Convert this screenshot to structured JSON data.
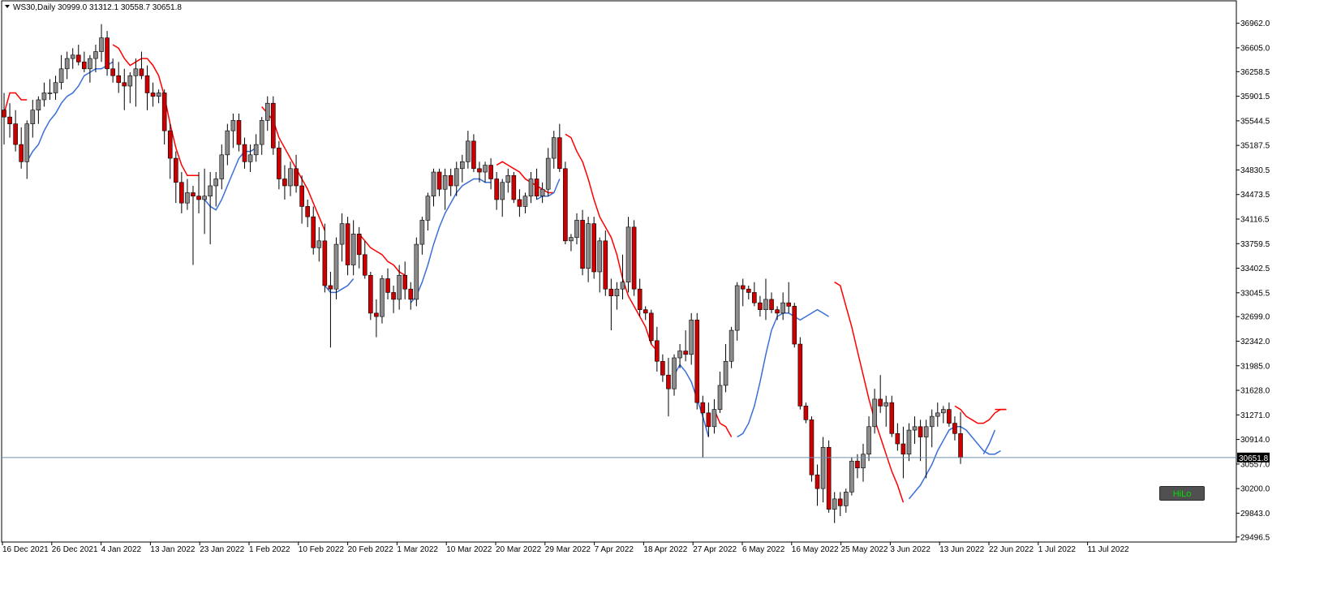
{
  "chart_header": {
    "symbol_info": "WS30,Daily  30999.0 31312.1 30558.7 30651.8"
  },
  "indicator_button": {
    "label": "HiLo"
  },
  "colors": {
    "up_candle": "#8c8c8c",
    "down_candle": "#cc0000",
    "hilo_upper": "#ff0000",
    "hilo_lower": "#3a6fd8",
    "price_line": "#6f8faf",
    "current_price_bg": "#000000",
    "current_price_text": "#ffffff"
  },
  "chart_data": {
    "type": "candlestick",
    "symbol": "WS30",
    "timeframe": "Daily",
    "ohlc_last": {
      "open": 30999.0,
      "high": 31312.1,
      "low": 30558.7,
      "close": 30651.8
    },
    "current_price": "30651.8",
    "y_ticks": [
      "36962.0",
      "36605.0",
      "36258.5",
      "35901.5",
      "35544.5",
      "35187.5",
      "34830.5",
      "34473.5",
      "34116.5",
      "33759.5",
      "33402.5",
      "33045.5",
      "32699.0",
      "32342.0",
      "31985.0",
      "31628.0",
      "31271.0",
      "30914.0",
      "30557.0",
      "30200.0",
      "29843.0",
      "29496.5"
    ],
    "ylim": [
      29400,
      37300
    ],
    "x_tick_labels": [
      "16 Dec 2021",
      "26 Dec 2021",
      "4 Jan 2022",
      "13 Jan 2022",
      "23 Jan 2022",
      "1 Feb 2022",
      "10 Feb 2022",
      "20 Feb 2022",
      "1 Mar 2022",
      "10 Mar 2022",
      "20 Mar 2022",
      "29 Mar 2022",
      "7 Apr 2022",
      "18 Apr 2022",
      "27 Apr 2022",
      "6 May 2022",
      "16 May 2022",
      "25 May 2022",
      "3 Jun 2022",
      "13 Jun 2022",
      "22 Jun 2022",
      "1 Jul 2022",
      "11 Jul 2022"
    ],
    "candles": [
      [
        35700,
        35950,
        35200,
        35600
      ],
      [
        35600,
        35800,
        35300,
        35500
      ],
      [
        35500,
        35700,
        35100,
        35200
      ],
      [
        35200,
        35450,
        34850,
        34950
      ],
      [
        34950,
        35550,
        34700,
        35500
      ],
      [
        35500,
        35850,
        35300,
        35700
      ],
      [
        35700,
        35900,
        35500,
        35850
      ],
      [
        35850,
        36100,
        35750,
        35950
      ],
      [
        35950,
        36150,
        35850,
        35950
      ],
      [
        35950,
        36200,
        35850,
        36100
      ],
      [
        36100,
        36500,
        36000,
        36300
      ],
      [
        36300,
        36550,
        36150,
        36450
      ],
      [
        36450,
        36600,
        36300,
        36500
      ],
      [
        36500,
        36650,
        36350,
        36400
      ],
      [
        36400,
        36550,
        36250,
        36300
      ],
      [
        36300,
        36500,
        36100,
        36450
      ],
      [
        36450,
        36650,
        36250,
        36550
      ],
      [
        36550,
        36950,
        36400,
        36750
      ],
      [
        36750,
        36850,
        36200,
        36300
      ],
      [
        36300,
        36450,
        36100,
        36200
      ],
      [
        36200,
        36400,
        35950,
        36100
      ],
      [
        36100,
        36300,
        35700,
        36050
      ],
      [
        36050,
        36250,
        35800,
        36200
      ],
      [
        36200,
        36450,
        35750,
        36300
      ],
      [
        36300,
        36550,
        36150,
        36200
      ],
      [
        36200,
        36350,
        35700,
        35950
      ],
      [
        35950,
        36100,
        35750,
        35900
      ],
      [
        35900,
        36000,
        35800,
        35950
      ],
      [
        35950,
        36000,
        35200,
        35400
      ],
      [
        35400,
        35500,
        34700,
        35000
      ],
      [
        35000,
        35100,
        34350,
        34650
      ],
      [
        34650,
        34800,
        34200,
        34350
      ],
      [
        34350,
        34700,
        34250,
        34500
      ],
      [
        34500,
        34600,
        33450,
        34450
      ],
      [
        34450,
        34800,
        34200,
        34400
      ],
      [
        34400,
        34850,
        33900,
        34450
      ],
      [
        34450,
        34800,
        33750,
        34600
      ],
      [
        34600,
        34800,
        34300,
        34700
      ],
      [
        34700,
        35200,
        34550,
        35050
      ],
      [
        35050,
        35500,
        34900,
        35400
      ],
      [
        35400,
        35650,
        35150,
        35550
      ],
      [
        35550,
        35650,
        35100,
        35200
      ],
      [
        35200,
        35300,
        34850,
        34950
      ],
      [
        34950,
        35200,
        34800,
        35050
      ],
      [
        35050,
        35350,
        34950,
        35200
      ],
      [
        35200,
        35600,
        35050,
        35550
      ],
      [
        35550,
        35900,
        35400,
        35800
      ],
      [
        35800,
        35900,
        35050,
        35150
      ],
      [
        35150,
        35250,
        34550,
        34700
      ],
      [
        34700,
        34900,
        34400,
        34600
      ],
      [
        34600,
        34950,
        34450,
        34850
      ],
      [
        34850,
        35050,
        34500,
        34600
      ],
      [
        34600,
        34750,
        34050,
        34300
      ],
      [
        34300,
        34400,
        34000,
        34150
      ],
      [
        34150,
        34300,
        33600,
        33700
      ],
      [
        33700,
        34000,
        33500,
        33800
      ],
      [
        33800,
        34050,
        33050,
        33150
      ],
      [
        33150,
        33350,
        32250,
        33100
      ],
      [
        33100,
        33850,
        32950,
        33750
      ],
      [
        33750,
        34200,
        33500,
        34050
      ],
      [
        34050,
        34150,
        33300,
        33450
      ],
      [
        33450,
        34100,
        33300,
        33900
      ],
      [
        33900,
        34000,
        33400,
        33600
      ],
      [
        33600,
        33800,
        33250,
        33300
      ],
      [
        33300,
        33350,
        32650,
        32750
      ],
      [
        32750,
        32950,
        32400,
        32700
      ],
      [
        32700,
        33300,
        32600,
        33250
      ],
      [
        33250,
        33400,
        32950,
        33050
      ],
      [
        33050,
        33150,
        32750,
        32950
      ],
      [
        32950,
        33450,
        32800,
        33300
      ],
      [
        33300,
        33500,
        32950,
        33100
      ],
      [
        33100,
        33200,
        32800,
        32950
      ],
      [
        32950,
        33850,
        32850,
        33750
      ],
      [
        33750,
        34150,
        33600,
        34100
      ],
      [
        34100,
        34500,
        33950,
        34450
      ],
      [
        34450,
        34850,
        34300,
        34800
      ],
      [
        34800,
        34850,
        34450,
        34550
      ],
      [
        34550,
        34850,
        34250,
        34750
      ],
      [
        34750,
        34850,
        34450,
        34600
      ],
      [
        34600,
        34950,
        34450,
        34850
      ],
      [
        34850,
        35050,
        34650,
        34950
      ],
      [
        34950,
        35400,
        34850,
        35250
      ],
      [
        35250,
        35350,
        34800,
        34850
      ],
      [
        34850,
        34950,
        34650,
        34800
      ],
      [
        34800,
        34950,
        34650,
        34900
      ],
      [
        34900,
        35000,
        34550,
        34700
      ],
      [
        34700,
        34800,
        34250,
        34400
      ],
      [
        34400,
        34700,
        34150,
        34650
      ],
      [
        34650,
        34850,
        34500,
        34750
      ],
      [
        34750,
        34800,
        34350,
        34400
      ],
      [
        34400,
        34550,
        34150,
        34300
      ],
      [
        34300,
        34500,
        34200,
        34450
      ],
      [
        34450,
        34800,
        34350,
        34700
      ],
      [
        34700,
        34850,
        34400,
        34450
      ],
      [
        34450,
        34650,
        34350,
        34550
      ],
      [
        34550,
        35150,
        34450,
        35000
      ],
      [
        35000,
        35400,
        34850,
        35300
      ],
      [
        35300,
        35500,
        34800,
        34850
      ],
      [
        34850,
        34950,
        33750,
        33800
      ],
      [
        33800,
        33900,
        33650,
        33850
      ],
      [
        33850,
        34200,
        33750,
        34100
      ],
      [
        34100,
        34250,
        33300,
        33400
      ],
      [
        33400,
        34150,
        33200,
        34050
      ],
      [
        34050,
        34150,
        33250,
        33350
      ],
      [
        33350,
        33850,
        33050,
        33800
      ],
      [
        33800,
        33950,
        33000,
        33100
      ],
      [
        33100,
        33250,
        32500,
        33000
      ],
      [
        33000,
        33200,
        32800,
        33100
      ],
      [
        33100,
        33600,
        32950,
        33200
      ],
      [
        33200,
        34150,
        33050,
        34000
      ],
      [
        34000,
        34100,
        33000,
        33100
      ],
      [
        33100,
        33250,
        32700,
        32800
      ],
      [
        32800,
        32850,
        32650,
        32750
      ],
      [
        32750,
        32800,
        32300,
        32350
      ],
      [
        32350,
        32550,
        31900,
        32050
      ],
      [
        32050,
        32150,
        31750,
        31850
      ],
      [
        31850,
        32100,
        31250,
        31650
      ],
      [
        31650,
        32150,
        31550,
        32100
      ],
      [
        32100,
        32300,
        31950,
        32200
      ],
      [
        32200,
        32500,
        32050,
        32150
      ],
      [
        32150,
        32750,
        32000,
        32650
      ],
      [
        32650,
        32750,
        31350,
        31450
      ],
      [
        31450,
        31550,
        30650,
        31300
      ],
      [
        31300,
        31450,
        30950,
        31100
      ],
      [
        31100,
        31500,
        31000,
        31350
      ],
      [
        31350,
        31900,
        31300,
        31700
      ],
      [
        31700,
        32300,
        31600,
        32050
      ],
      [
        32050,
        32550,
        31950,
        32500
      ],
      [
        32500,
        33200,
        32350,
        33150
      ],
      [
        33150,
        33250,
        32850,
        33100
      ],
      [
        33100,
        33150,
        32950,
        33050
      ],
      [
        33050,
        33200,
        32850,
        32900
      ],
      [
        32900,
        33000,
        32700,
        32800
      ],
      [
        32800,
        33250,
        32650,
        32950
      ],
      [
        32950,
        33050,
        32750,
        32800
      ],
      [
        32800,
        32850,
        32650,
        32750
      ],
      [
        32750,
        33050,
        32650,
        32900
      ],
      [
        32900,
        33200,
        32750,
        32850
      ],
      [
        32850,
        32900,
        32250,
        32300
      ],
      [
        32300,
        32400,
        31350,
        31400
      ],
      [
        31400,
        31450,
        31150,
        31200
      ],
      [
        31200,
        31250,
        30300,
        30400
      ],
      [
        30400,
        30550,
        29950,
        30200
      ],
      [
        30200,
        30950,
        30000,
        30800
      ],
      [
        30800,
        30900,
        29850,
        29900
      ],
      [
        29900,
        30150,
        29700,
        30050
      ],
      [
        30050,
        30150,
        29800,
        29950
      ],
      [
        29950,
        30200,
        29850,
        30150
      ],
      [
        30150,
        30650,
        30100,
        30600
      ],
      [
        30600,
        30700,
        30350,
        30500
      ],
      [
        30500,
        30850,
        30300,
        30700
      ],
      [
        30700,
        31250,
        30600,
        31100
      ],
      [
        31100,
        31650,
        31000,
        31500
      ],
      [
        31500,
        31850,
        31300,
        31400
      ],
      [
        31400,
        31550,
        31100,
        31450
      ],
      [
        31450,
        31550,
        30950,
        31000
      ],
      [
        31000,
        31150,
        30750,
        30850
      ],
      [
        30850,
        31100,
        30350,
        30700
      ],
      [
        30700,
        31150,
        30600,
        31050
      ],
      [
        31050,
        31250,
        30850,
        31100
      ],
      [
        31100,
        31200,
        30600,
        30950
      ],
      [
        30950,
        31200,
        30350,
        31100
      ],
      [
        31100,
        31350,
        30800,
        31250
      ],
      [
        31250,
        31450,
        31100,
        31300
      ],
      [
        31300,
        31400,
        31150,
        31350
      ],
      [
        31350,
        31450,
        31100,
        31150
      ],
      [
        31150,
        31250,
        30900,
        31000
      ],
      [
        30999,
        31312.1,
        30558.7,
        30651.8
      ]
    ],
    "hilo_segments": [
      {
        "dir": "upper",
        "from": 0,
        "values": [
          35650,
          35950,
          35950,
          35850,
          35850
        ]
      },
      {
        "dir": "lower",
        "from": 4,
        "values": [
          34950,
          35100,
          35200,
          35400,
          35550,
          35650,
          35800,
          35900,
          35950,
          36050,
          36200,
          36250,
          36300,
          36300,
          36350,
          36400
        ]
      },
      {
        "dir": "upper",
        "from": 19,
        "values": [
          36650,
          36600,
          36450,
          36350,
          36400,
          36450,
          36450,
          36350,
          36200,
          35900,
          35500,
          35150,
          34900,
          34750,
          34750,
          34750
        ]
      },
      {
        "dir": "lower",
        "from": 35,
        "values": [
          34400,
          34300,
          34250,
          34400,
          34600,
          34800,
          35000,
          35100,
          35100,
          35150
        ]
      },
      {
        "dir": "upper",
        "from": 45,
        "values": [
          35750,
          35650,
          35550,
          35300,
          35150,
          35000,
          34850,
          34700,
          34550,
          34350,
          34150,
          33950
        ]
      },
      {
        "dir": "lower",
        "from": 56,
        "values": [
          33150,
          33050,
          33050,
          33100,
          33150,
          33250
        ]
      },
      {
        "dir": "upper",
        "from": 62,
        "values": [
          33900,
          33800,
          33700,
          33650,
          33600,
          33500,
          33450,
          33350,
          33300
        ]
      },
      {
        "dir": "lower",
        "from": 71,
        "values": [
          32900,
          33000,
          33200,
          33450,
          33750,
          34000,
          34200,
          34350,
          34500,
          34600,
          34650,
          34700,
          34700,
          34650,
          34650
        ]
      },
      {
        "dir": "upper",
        "from": 86,
        "values": [
          34900,
          34950,
          34900,
          34850,
          34800,
          34700,
          34650,
          34600,
          34550,
          34500,
          34500
        ]
      },
      {
        "dir": "lower",
        "from": 93,
        "values": [
          34400,
          34450,
          34450,
          34500,
          34700
        ]
      },
      {
        "dir": "upper",
        "from": 98,
        "values": [
          35350,
          35300,
          35100,
          34950,
          34700,
          34400,
          34150,
          34000,
          33850,
          33600,
          33250,
          33000,
          32850,
          32700,
          32550,
          32300,
          32200
        ]
      },
      {
        "dir": "lower",
        "from": 117,
        "values": [
          31850,
          32000,
          31900,
          31750,
          31500,
          31250,
          30950
        ]
      },
      {
        "dir": "upper",
        "from": 124,
        "values": [
          31350,
          31150,
          31100,
          30950
        ]
      },
      {
        "dir": "lower",
        "from": 128,
        "values": [
          30950,
          31000,
          31150,
          31400,
          31750,
          32150,
          32500,
          32700,
          32750,
          32750,
          32700,
          32650,
          32700,
          32750,
          32800,
          32750,
          32700
        ]
      },
      {
        "dir": "upper",
        "from": 145,
        "values": [
          33200,
          33150,
          32850,
          32550,
          32200,
          31850,
          31500,
          31200,
          30950,
          30700,
          30450,
          30250,
          30000
        ]
      },
      {
        "dir": "lower",
        "from": 158,
        "values": [
          30050,
          30150,
          30250,
          30400,
          30550,
          30750,
          30900,
          31050,
          31100,
          31100,
          31050,
          30950,
          30850,
          30750,
          30700,
          30700,
          30750
        ]
      },
      {
        "dir": "upper",
        "from": 166,
        "values": [
          31400,
          31350,
          31250,
          31200,
          31150,
          31150,
          31200,
          31300,
          31350,
          31350
        ]
      },
      {
        "dir": "lower",
        "from": 171,
        "values": [
          30700,
          30850,
          31050
        ]
      },
      {
        "dir": "upper",
        "from": 173,
        "values": [
          31350,
          31350,
          31350
        ]
      }
    ]
  }
}
